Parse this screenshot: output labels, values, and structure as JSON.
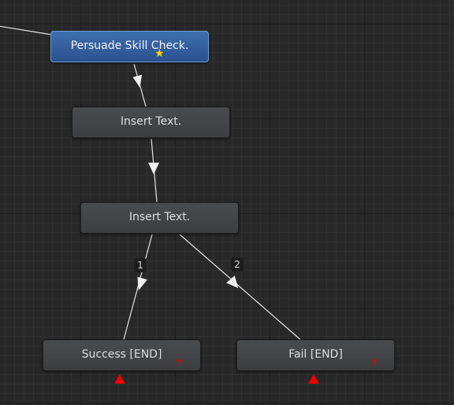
{
  "nodes": {
    "persuade": {
      "label": "Persuade Skill Check.",
      "has_star": true
    },
    "insert1": {
      "label": "Insert Text."
    },
    "insert2": {
      "label": "Insert Text."
    },
    "success": {
      "label": "Success [END]"
    },
    "fail": {
      "label": "Fail [END]"
    }
  },
  "branches": {
    "left": {
      "label": "1"
    },
    "right": {
      "label": "2"
    }
  },
  "colors": {
    "background": "#282828",
    "node": "#454648",
    "selected_node": "#3561a1",
    "connection": "#e6e6e6",
    "end_marker": "#f00000",
    "star": "#ffd21f"
  },
  "icons": {
    "star": "star-icon",
    "end_marker": "red-triangle-icon",
    "key": "red-key-icon"
  }
}
